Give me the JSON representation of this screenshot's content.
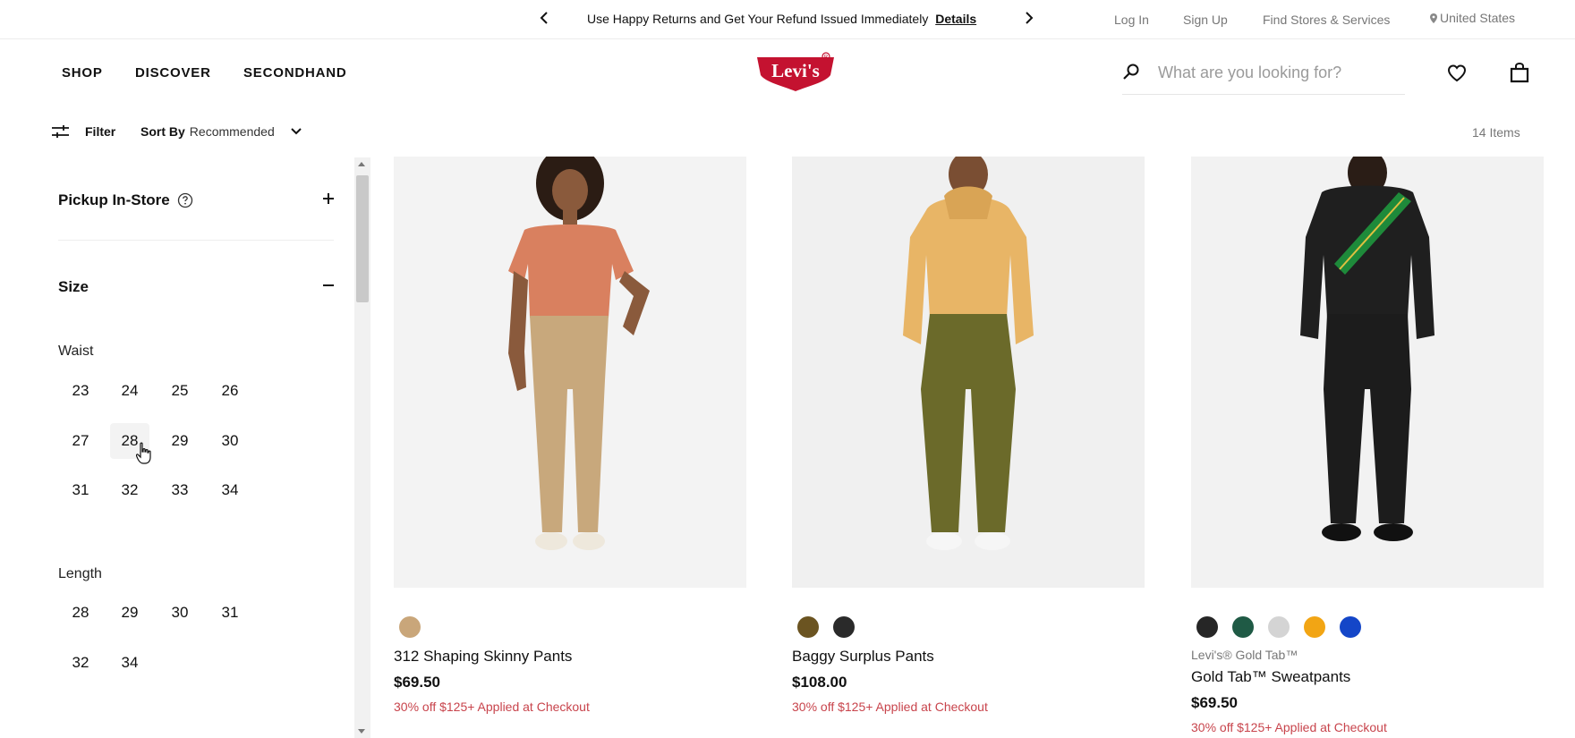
{
  "promo": {
    "text": "Use Happy Returns and Get Your Refund Issued Immediately",
    "link": "Details"
  },
  "utility": {
    "login": "Log In",
    "signup": "Sign Up",
    "stores": "Find Stores & Services",
    "country": "United States"
  },
  "nav": {
    "shop": "SHOP",
    "discover": "DISCOVER",
    "secondhand": "SECONDHAND"
  },
  "logo_text": "Levi's",
  "search": {
    "placeholder": "What are you looking for?"
  },
  "toolbar": {
    "filter": "Filter",
    "sort_label": "Sort By",
    "sort_value": "Recommended",
    "item_count": "14 Items"
  },
  "filters": {
    "pickup": "Pickup In-Store",
    "size": "Size",
    "waist_label": "Waist",
    "waist": [
      "23",
      "24",
      "25",
      "26",
      "27",
      "28",
      "29",
      "30",
      "31",
      "32",
      "33",
      "34"
    ],
    "length_label": "Length",
    "length": [
      "28",
      "29",
      "30",
      "31",
      "32",
      "34"
    ]
  },
  "products": [
    {
      "name": "312 Shaping Skinny Pants",
      "price": "$69.50",
      "promo": "30% off $125+ Applied at Checkout",
      "swatches": [
        "#c9a67a"
      ]
    },
    {
      "name": "Baggy Surplus Pants",
      "price": "$108.00",
      "promo": "30% off $125+ Applied at Checkout",
      "swatches": [
        "#6b5421",
        "#2a2a2a"
      ]
    },
    {
      "brand": "Levi's® Gold Tab™",
      "name": "Gold Tab™ Sweatpants",
      "price": "$69.50",
      "promo": "30% off $125+ Applied at Checkout",
      "swatches": [
        "#262626",
        "#1f5a45",
        "#d4d4d4",
        "#f2a514",
        "#1446c8"
      ]
    }
  ],
  "colors": {
    "brand_red": "#c41230",
    "promo_red": "#c8444c"
  }
}
